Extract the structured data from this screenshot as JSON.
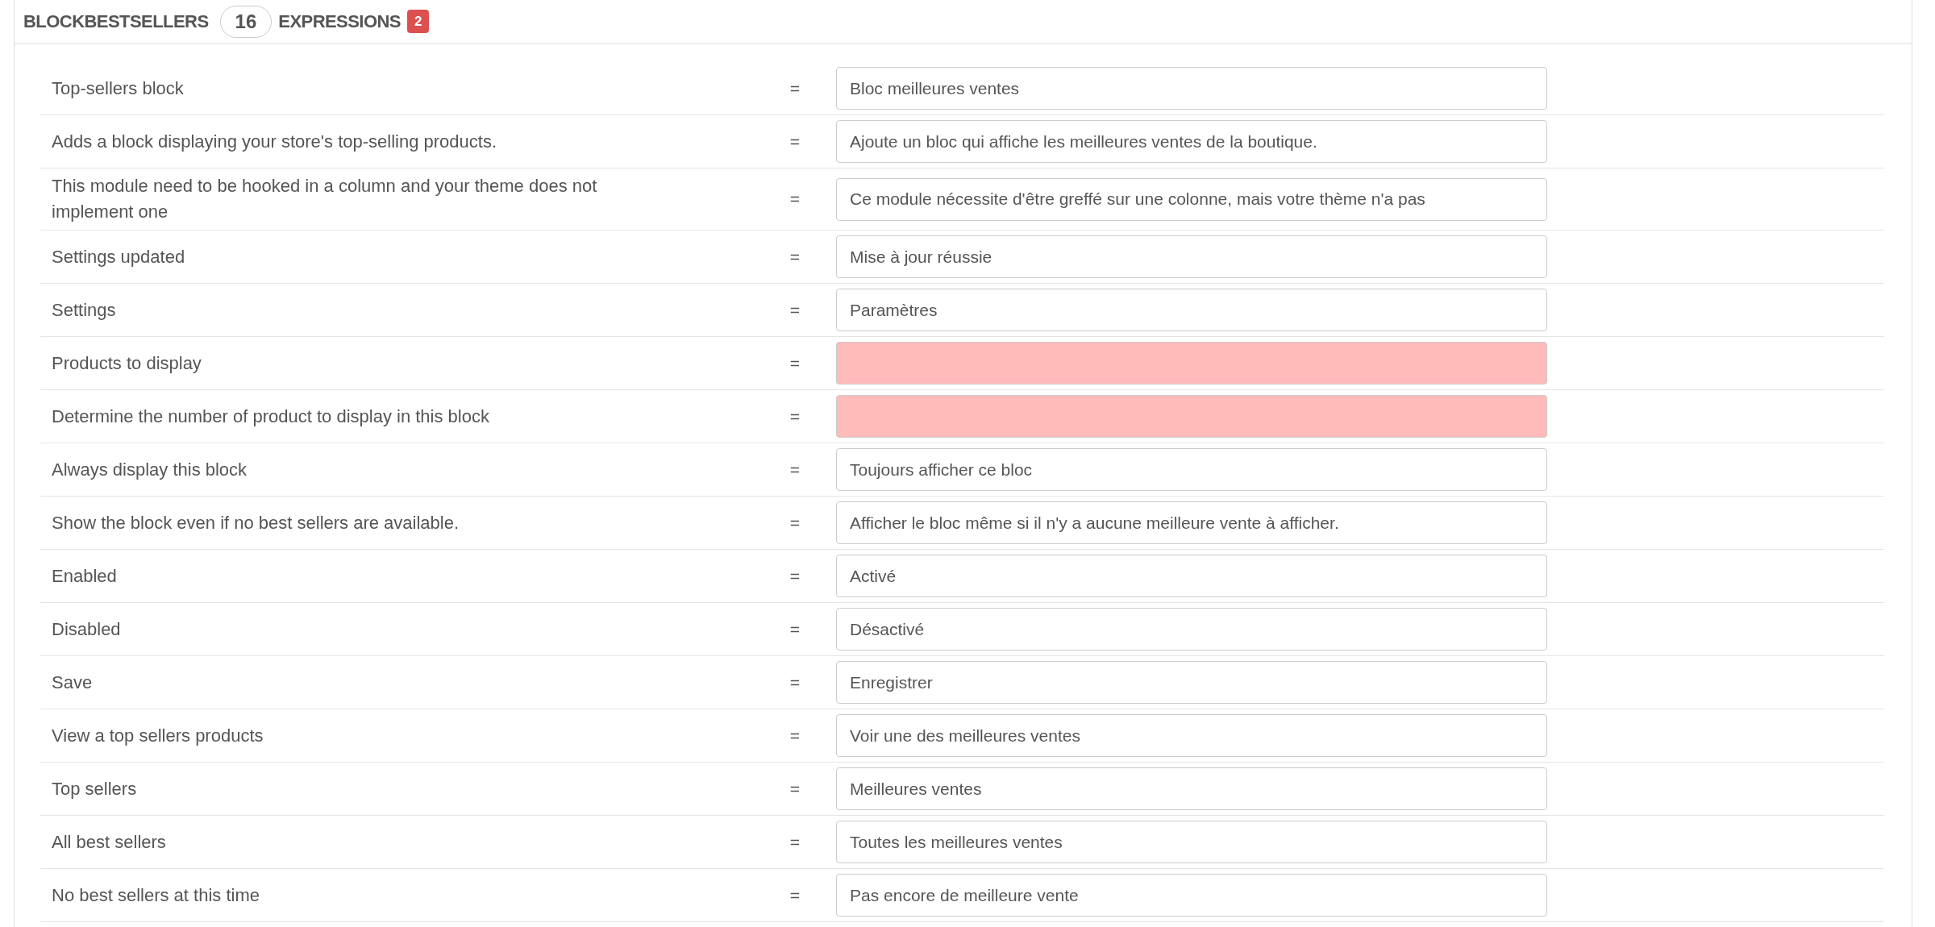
{
  "header": {
    "module": "BLOCKBESTSELLERS",
    "count": "16",
    "unit": "EXPRESSIONS",
    "missing_count": "2"
  },
  "rows": [
    {
      "source": "Top-sellers block",
      "sign": "=",
      "translation": "Bloc meilleures ventes",
      "missing": false
    },
    {
      "source": "Adds a block displaying your store's top-selling products.",
      "sign": "=",
      "translation": "Ajoute un bloc qui affiche les meilleures ventes de la boutique.",
      "missing": false
    },
    {
      "source": "This module need to be hooked in a column and your theme does not implement one",
      "sign": "=",
      "translation": "Ce module nécessite d'être greffé sur une colonne, mais votre thème n'a pas",
      "missing": false
    },
    {
      "source": "Settings updated",
      "sign": "=",
      "translation": "Mise à jour réussie",
      "missing": false
    },
    {
      "source": "Settings",
      "sign": "=",
      "translation": "Paramètres",
      "missing": false
    },
    {
      "source": "Products to display",
      "sign": "=",
      "missing": true
    },
    {
      "source": "Determine the number of product to display in this block",
      "sign": "=",
      "missing": true
    },
    {
      "source": "Always display this block",
      "sign": "=",
      "translation": "Toujours afficher ce bloc",
      "missing": false
    },
    {
      "source": "Show the block even if no best sellers are available.",
      "sign": "=",
      "translation": "Afficher le bloc même si il n'y a aucune meilleure vente à afficher.",
      "missing": false
    },
    {
      "source": "Enabled",
      "sign": "=",
      "translation": "Activé",
      "missing": false
    },
    {
      "source": "Disabled",
      "sign": "=",
      "translation": "Désactivé",
      "missing": false
    },
    {
      "source": "Save",
      "sign": "=",
      "translation": "Enregistrer",
      "missing": false
    },
    {
      "source": "View a top sellers products",
      "sign": "=",
      "translation": "Voir une des meilleures ventes",
      "missing": false
    },
    {
      "source": "Top sellers",
      "sign": "=",
      "translation": "Meilleures ventes",
      "missing": false
    },
    {
      "source": "All best sellers",
      "sign": "=",
      "translation": "Toutes les meilleures ventes",
      "missing": false
    },
    {
      "source": "No best sellers at this time",
      "sign": "=",
      "translation": "Pas encore de meilleure vente",
      "missing": false
    }
  ]
}
